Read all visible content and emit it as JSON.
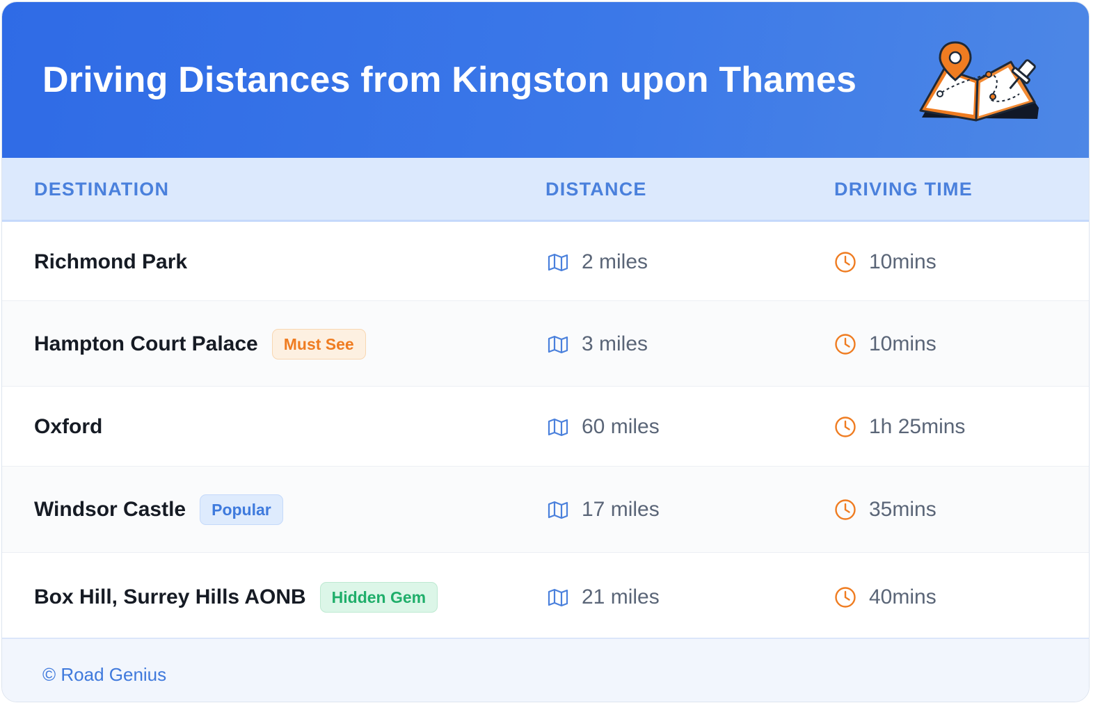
{
  "header": {
    "title": "Driving Distances from Kingston upon Thames",
    "illustration": "map-with-pins-icon"
  },
  "table": {
    "columns": [
      "DESTINATION",
      "DISTANCE",
      "DRIVING TIME"
    ],
    "rows": [
      {
        "destination": "Richmond Park",
        "badge": "",
        "distance": "2 miles",
        "time": "10mins"
      },
      {
        "destination": "Hampton Court Palace",
        "badge": "Must See",
        "badge_style": "orange",
        "distance": "3 miles",
        "time": "10mins"
      },
      {
        "destination": "Oxford",
        "badge": "",
        "distance": "60 miles",
        "time": "1h 25mins"
      },
      {
        "destination": "Windsor Castle",
        "badge": "Popular",
        "badge_style": "blue",
        "distance": "17 miles",
        "time": "35mins"
      },
      {
        "destination": "Box Hill, Surrey Hills AONB",
        "badge": "Hidden Gem",
        "badge_style": "green",
        "distance": "21 miles",
        "time": "40mins"
      }
    ],
    "distance_icon": "map-icon",
    "time_icon": "clock-icon"
  },
  "footer": {
    "credit": "© Road Genius"
  },
  "colors": {
    "header_bg": "#2f6be6",
    "accent": "#4a80dc",
    "icon_blue": "#4a80dc",
    "icon_orange": "#ef7c21"
  }
}
